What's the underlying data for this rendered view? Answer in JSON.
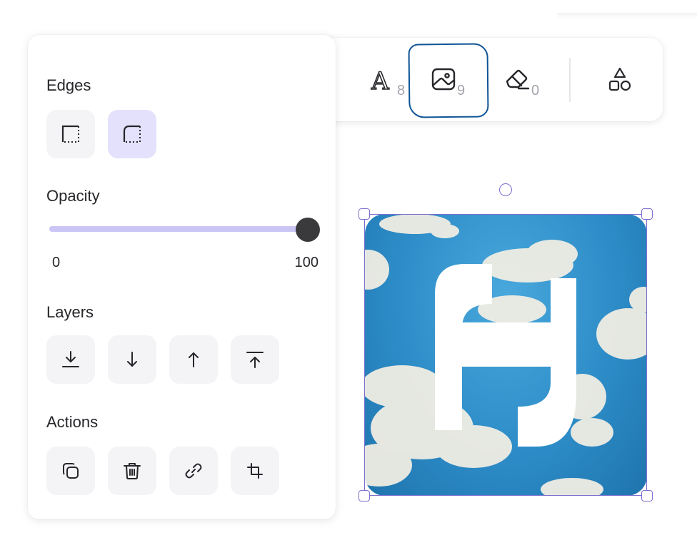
{
  "toolbar": {
    "tools": [
      {
        "id": "text",
        "icon": "text-tool-icon",
        "count": "8"
      },
      {
        "id": "image",
        "icon": "image-tool-icon",
        "count": "9",
        "active": true
      },
      {
        "id": "eraser",
        "icon": "eraser-tool-icon",
        "count": "0"
      },
      {
        "id": "shapes",
        "icon": "shapes-tool-icon"
      }
    ]
  },
  "panel": {
    "edges": {
      "label": "Edges",
      "options": [
        "square-corners-icon",
        "rounded-corners-icon"
      ],
      "selected": 1
    },
    "opacity": {
      "label": "Opacity",
      "min_label": "0",
      "max_label": "100",
      "value": 100
    },
    "layers": {
      "label": "Layers",
      "buttons": [
        "send-to-back-icon",
        "send-backward-icon",
        "bring-forward-icon",
        "bring-to-front-icon"
      ]
    },
    "actions": {
      "label": "Actions",
      "buttons": [
        "duplicate-icon",
        "delete-icon",
        "link-icon",
        "crop-icon"
      ]
    }
  },
  "colors": {
    "accent": "#7b6fd0",
    "active_button": "#e3e1fb",
    "sky": "#2d8cc7",
    "annotation_ring": "#0f5596"
  }
}
